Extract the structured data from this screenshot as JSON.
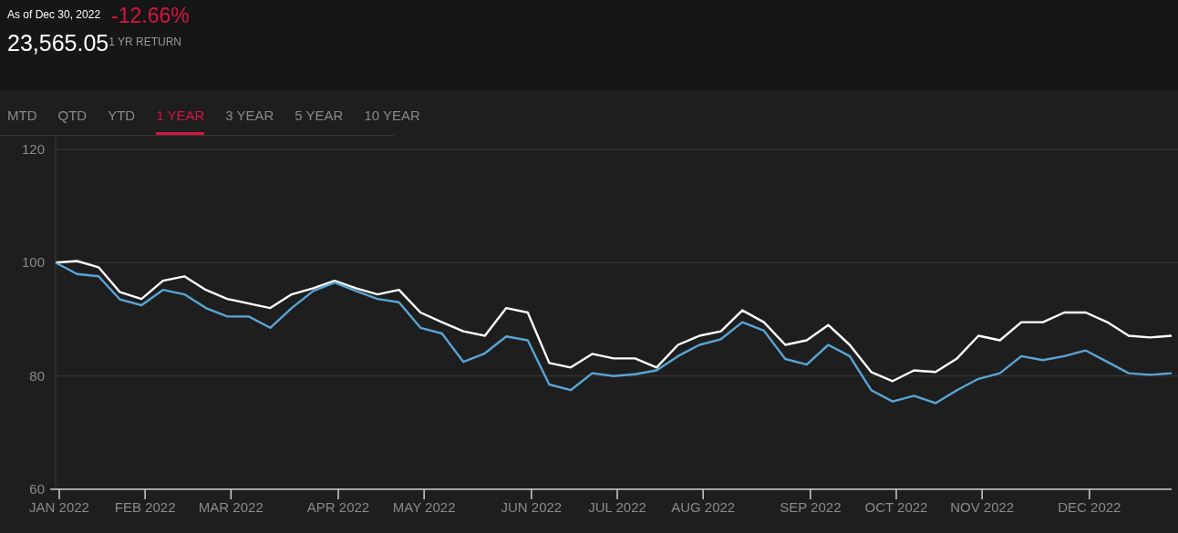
{
  "header": {
    "as_of": "As of Dec 30, 2022",
    "return_value": "-12.66%",
    "price": "23,565.05",
    "return_label": "1 YR RETURN"
  },
  "tabs": [
    {
      "label": "MTD",
      "selected": false
    },
    {
      "label": "QTD",
      "selected": false
    },
    {
      "label": "YTD",
      "selected": false
    },
    {
      "label": "1 YEAR",
      "selected": true
    },
    {
      "label": "3 YEAR",
      "selected": false
    },
    {
      "label": "5 YEAR",
      "selected": false
    },
    {
      "label": "10 YEAR",
      "selected": false
    }
  ],
  "chart": {
    "chart_data": {
      "type": "line",
      "categories": [
        "JAN 2022",
        null,
        null,
        null,
        "FEB 2022",
        null,
        null,
        null,
        "MAR 2022",
        null,
        null,
        null,
        null,
        "APR 2022",
        null,
        null,
        null,
        "MAY 2022",
        null,
        null,
        null,
        null,
        "JUN 2022",
        null,
        null,
        null,
        "JUL 2022",
        null,
        null,
        null,
        "AUG 2022",
        null,
        null,
        null,
        null,
        "SEP 2022",
        null,
        null,
        null,
        "OCT 2022",
        null,
        null,
        null,
        "NOV 2022",
        null,
        null,
        null,
        null,
        "DEC 2022",
        null,
        null,
        null,
        null
      ],
      "series": [
        {
          "color": "#ffffff",
          "values": [
            100,
            100.3,
            99.2,
            94.8,
            93.6,
            96.8,
            97.6,
            95.2,
            93.6,
            92.8,
            92,
            94.4,
            95.5,
            96.8,
            95.5,
            94.4,
            95.2,
            91.2,
            89.5,
            87.9,
            87.1,
            92,
            91.2,
            82.3,
            81.5,
            83.9,
            83.1,
            83.1,
            81.5,
            85.5,
            87.1,
            87.9,
            91.6,
            89.5,
            85.5,
            86.3,
            89,
            85.5,
            80.7,
            79.1,
            81,
            80.7,
            83.1,
            87.1,
            86.3,
            89.5,
            89.5,
            91.2,
            91.2,
            89.5,
            87.1,
            86.8,
            87.1
          ]
        },
        {
          "color": "#5aa5d6",
          "values": [
            100,
            98,
            97.6,
            93.5,
            92.5,
            95.2,
            94.4,
            92,
            90.5,
            90.5,
            88.5,
            92,
            95,
            96.5,
            95,
            93.6,
            93,
            88.5,
            87.5,
            82.5,
            84,
            87,
            86.3,
            78.5,
            77.5,
            80.5,
            80,
            80.3,
            81,
            83.5,
            85.5,
            86.5,
            89.5,
            88,
            83,
            82,
            85.5,
            83.5,
            77.5,
            75.5,
            76.5,
            75.2,
            77.5,
            79.5,
            80.5,
            83.5,
            82.8,
            83.5,
            84.5,
            82.5,
            80.5,
            80.2,
            80.5
          ]
        }
      ],
      "ylim": [
        60,
        120
      ],
      "yticks": [
        60,
        80,
        100,
        120
      ]
    }
  }
}
